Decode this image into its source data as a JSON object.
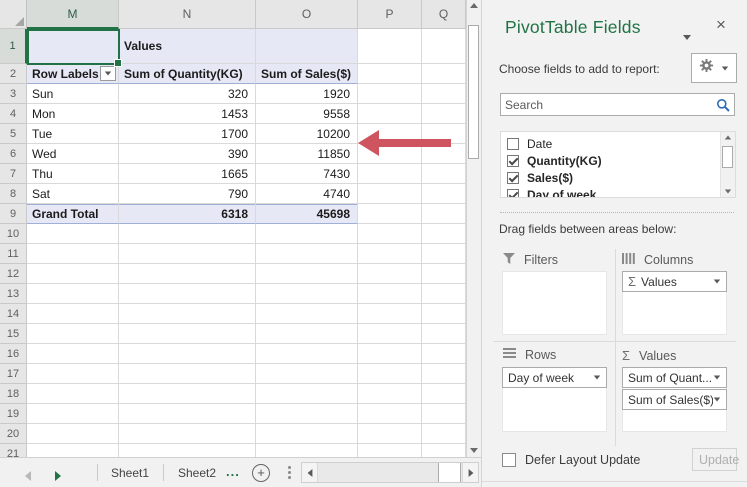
{
  "sheet": {
    "col_headers": [
      "M",
      "N",
      "O",
      "P",
      "Q"
    ],
    "active_cell": "M1",
    "active_cell_column": "M",
    "active_cell_row": 1,
    "visible_rows": 21,
    "pivot": {
      "values_header": "Values",
      "row_labels_header": "Row Labels",
      "col1_header": "Sum of Quantity(KG)",
      "col2_header": "Sum of Sales($)",
      "rows": [
        {
          "label": "Sun",
          "quantity": "320",
          "sales": "1920"
        },
        {
          "label": "Mon",
          "quantity": "1453",
          "sales": "9558"
        },
        {
          "label": "Tue",
          "quantity": "1700",
          "sales": "10200"
        },
        {
          "label": "Wed",
          "quantity": "390",
          "sales": "11850"
        },
        {
          "label": "Thu",
          "quantity": "1665",
          "sales": "7430"
        },
        {
          "label": "Sat",
          "quantity": "790",
          "sales": "4740"
        }
      ],
      "grand_total": {
        "label": "Grand Total",
        "quantity": "6318",
        "sales": "45698"
      }
    },
    "tabs": [
      "Sheet1",
      "Sheet2"
    ],
    "tabs_overflow": "...",
    "new_sheet_glyph": "+"
  },
  "pane": {
    "title": "PivotTable Fields",
    "close_glyph": "×",
    "choose_fields_label": "Choose fields to add to report:",
    "search_placeholder": "Search",
    "fields": [
      {
        "label": "Date",
        "checked": false
      },
      {
        "label": "Quantity(KG)",
        "checked": true
      },
      {
        "label": "Sales($)",
        "checked": true
      },
      {
        "label": "Day of week",
        "checked": true
      }
    ],
    "drag_label": "Drag fields between areas below:",
    "areas": {
      "filters": {
        "label": "Filters",
        "items": []
      },
      "columns": {
        "label": "Columns",
        "items": [
          {
            "label": "Values",
            "sigma": true
          }
        ]
      },
      "rows": {
        "label": "Rows",
        "items": [
          {
            "label": "Day of week",
            "sigma": false
          }
        ]
      },
      "values": {
        "label": "Values",
        "items": [
          {
            "label": "Sum of Quant...",
            "sigma": false
          },
          {
            "label": "Sum of Sales($)",
            "sigma": false
          }
        ]
      }
    },
    "defer_label": "Defer Layout Update",
    "update_label": "Update"
  },
  "colors": {
    "accent_green": "#217346",
    "pivot_fill": "#E6E9F5",
    "pivot_border_blue": "#9FAFD7",
    "annotation_arrow_red": "#CE5460",
    "search_icon_blue": "#2E6DB5"
  }
}
